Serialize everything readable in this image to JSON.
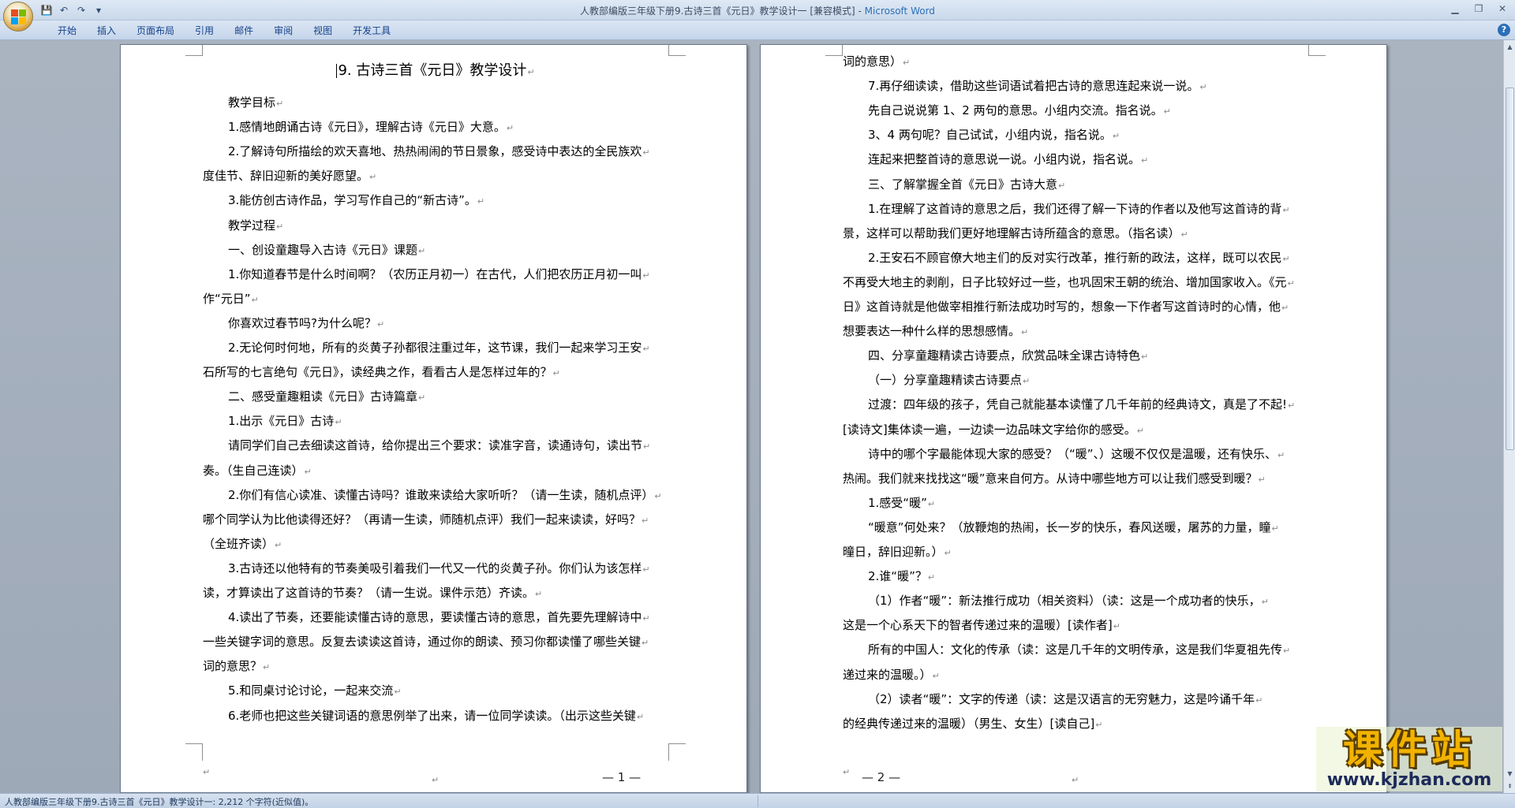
{
  "window": {
    "title": "人教部编版三年级下册9.古诗三首《元日》教学设计一 [兼容模式]",
    "app_name": "Microsoft Word",
    "title_separator": " - "
  },
  "quick_access": [
    {
      "name": "save-icon",
      "glyph": "💾"
    },
    {
      "name": "undo-icon",
      "glyph": "↶"
    },
    {
      "name": "redo-icon",
      "glyph": "↷"
    },
    {
      "name": "customize-icon",
      "glyph": "▾"
    }
  ],
  "ribbon": {
    "tabs": [
      "开始",
      "插入",
      "页面布局",
      "引用",
      "邮件",
      "审阅",
      "视图",
      "开发工具"
    ]
  },
  "page1": {
    "title": "9. 古诗三首《元日》教学设计",
    "lines": [
      {
        "text": "教学目标",
        "indent": true
      },
      {
        "text": "1.感情地朗诵古诗《元日》，理解古诗《元日》大意。",
        "indent": true
      },
      {
        "text": "2.了解诗句所描绘的欢天喜地、热热闹闹的节日景象，感受诗中表达的全民族欢",
        "indent": true
      },
      {
        "text": "度佳节、辞旧迎新的美好愿望。",
        "indent": false
      },
      {
        "text": "3.能仿创古诗作品，学习写作自己的“新古诗”。",
        "indent": true
      },
      {
        "text": "教学过程",
        "indent": true
      },
      {
        "text": "一、创设童趣导入古诗《元日》课题",
        "indent": true
      },
      {
        "text": "1.你知道春节是什么时间啊？（农历正月初一）在古代，人们把农历正月初一叫",
        "indent": true
      },
      {
        "text": "作“元日”",
        "indent": false
      },
      {
        "text": "你喜欢过春节吗?为什么呢？",
        "indent": true
      },
      {
        "text": "2.无论何时何地，所有的炎黄子孙都很注重过年，这节课，我们一起来学习王安",
        "indent": true
      },
      {
        "text": "石所写的七言绝句《元日》，读经典之作，看看古人是怎样过年的？",
        "indent": false
      },
      {
        "text": "二、感受童趣粗读《元日》古诗篇章",
        "indent": true
      },
      {
        "text": "1.出示《元日》古诗",
        "indent": true
      },
      {
        "text": "请同学们自己去细读这首诗，给你提出三个要求：读准字音，读通诗句，读出节",
        "indent": true
      },
      {
        "text": "奏。（生自己连读）",
        "indent": false
      },
      {
        "text": "2.你们有信心读准、读懂古诗吗？谁敢来读给大家听听？（请一生读，随机点评）",
        "indent": true
      },
      {
        "text": "哪个同学认为比他读得还好？（再请一生读，师随机点评）我们一起来读读，好吗？",
        "indent": false
      },
      {
        "text": "（全班齐读）",
        "indent": false
      },
      {
        "text": "3.古诗还以他特有的节奏美吸引着我们一代又一代的炎黄子孙。你们认为该怎样",
        "indent": true
      },
      {
        "text": "读，才算读出了这首诗的节奏？（请一生说。课件示范）齐读。",
        "indent": false
      },
      {
        "text": "4.读出了节奏，还要能读懂古诗的意思，要读懂古诗的意思，首先要先理解诗中",
        "indent": true
      },
      {
        "text": "一些关键字词的意思。反复去读读这首诗，通过你的朗读、预习你都读懂了哪些关键",
        "indent": false
      },
      {
        "text": "词的意思？",
        "indent": false
      },
      {
        "text": "5.和同桌讨论讨论，一起来交流",
        "indent": true
      },
      {
        "text": "6.老师也把这些关键词语的意思例举了出来，请一位同学读读。（出示这些关键",
        "indent": true
      }
    ],
    "page_number": "— 1 —"
  },
  "page2": {
    "lines": [
      {
        "text": "词的意思）",
        "indent": false
      },
      {
        "text": "7.再仔细读读，借助这些词语试着把古诗的意思连起来说一说。",
        "indent": true
      },
      {
        "text": "先自己说说第 1、2 两句的意思。小组内交流。指名说。",
        "indent": true
      },
      {
        "text": "3、4 两句呢？自己试试，小组内说，指名说。",
        "indent": true
      },
      {
        "text": "连起来把整首诗的意思说一说。小组内说，指名说。",
        "indent": true
      },
      {
        "text": "三、了解掌握全首《元日》古诗大意",
        "indent": true
      },
      {
        "text": "1.在理解了这首诗的意思之后，我们还得了解一下诗的作者以及他写这首诗的背",
        "indent": true
      },
      {
        "text": "景，这样可以帮助我们更好地理解古诗所蕴含的意思。（指名读）",
        "indent": false
      },
      {
        "text": "2.王安石不顾官僚大地主们的反对实行改革，推行新的政法，这样，既可以农民",
        "indent": true
      },
      {
        "text": "不再受大地主的剥削，日子比较好过一些，也巩固宋王朝的统治、增加国家收入。《元",
        "indent": false
      },
      {
        "text": "日》这首诗就是他做宰相推行新法成功时写的，想象一下作者写这首诗时的心情，他",
        "indent": false
      },
      {
        "text": "想要表达一种什么样的思想感情。",
        "indent": false
      },
      {
        "text": "四、分享童趣精读古诗要点，欣赏品味全课古诗特色",
        "indent": true
      },
      {
        "text": "（一）分享童趣精读古诗要点",
        "indent": true
      },
      {
        "text": "过渡：四年级的孩子，凭自己就能基本读懂了几千年前的经典诗文，真是了不起!",
        "indent": true
      },
      {
        "text": "[读诗文]集体读一遍，一边读一边品味文字给你的感受。",
        "indent": false
      },
      {
        "text": "诗中的哪个字最能体现大家的感受？（“暖”、）这暖不仅仅是温暖，还有快乐、",
        "indent": true
      },
      {
        "text": "热闹。我们就来找找这“暖”意来自何方。从诗中哪些地方可以让我们感受到暖？",
        "indent": false
      },
      {
        "text": "1.感受“暖”",
        "indent": true
      },
      {
        "text": "“暖意”何处来？（放鞭炮的热闹，长一岁的快乐，春风送暖，屠苏的力量，瞳",
        "indent": true
      },
      {
        "text": "曈日，辞旧迎新。）",
        "indent": false
      },
      {
        "text": "2.谁“暖”？",
        "indent": true
      },
      {
        "text": "（1）作者“暖”：新法推行成功（相关资料）（读：这是一个成功者的快乐，",
        "indent": true
      },
      {
        "text": "这是一个心系天下的智者传递过来的温暖）[读作者]",
        "indent": false
      },
      {
        "text": "所有的中国人：文化的传承（读：这是几千年的文明传承，这是我们华夏祖先传",
        "indent": true
      },
      {
        "text": "递过来的温暖。）",
        "indent": false
      },
      {
        "text": "（2）读者“暖”：文字的传递（读：这是汉语言的无穷魅力，这是吟诵千年",
        "indent": true
      },
      {
        "text": "的经典传递过来的温暖）（男生、女生）[读自己]",
        "indent": false
      }
    ],
    "page_number": "— 2 —"
  },
  "statusbar": {
    "text": "人教部编版三年级下册9.古诗三首《元日》教学设计一: 2,212 个字符(近似值)。"
  },
  "watermark": {
    "title": "课件站",
    "url": "www.kjzhan.com"
  },
  "colors": {
    "ribbon_text": "#15428b",
    "workspace": "#a9b4c2",
    "watermark_gold": "#f2b300"
  }
}
